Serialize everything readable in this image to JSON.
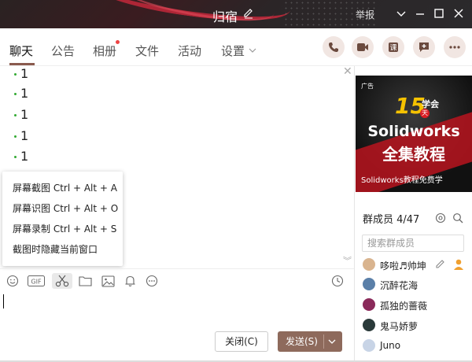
{
  "window": {
    "title": "归宿",
    "report": "举报"
  },
  "tabs": [
    {
      "label": "聊天"
    },
    {
      "label": "公告"
    },
    {
      "label": "相册"
    },
    {
      "label": "文件"
    },
    {
      "label": "活动"
    },
    {
      "label": "设置"
    }
  ],
  "messages": [
    "1",
    "1",
    "1",
    "1",
    "1"
  ],
  "context_menu": [
    "屏幕截图 Ctrl + Alt + A",
    "屏幕识图 Ctrl + Alt + O",
    "屏幕录制 Ctrl + Alt + S",
    "截图时隐藏当前窗口"
  ],
  "toolbar": {
    "gif_label": "GIF"
  },
  "buttons": {
    "close": "关闭(C)",
    "send": "发送(S)"
  },
  "ad": {
    "tag": "广告",
    "num": "15",
    "xuehui": "学会",
    "tian": "天",
    "line1": "Solidworks",
    "line2": "全集教程",
    "footer": "Solidworks教程免费学"
  },
  "members": {
    "header": "群成员 4/47",
    "search_placeholder": "搜索群成员",
    "list": [
      {
        "name": "哆啦♬帅坤"
      },
      {
        "name": "沉醉花海"
      },
      {
        "name": "孤独的蔷薇"
      },
      {
        "name": "鬼马娇萝"
      },
      {
        "name": "Juno"
      }
    ]
  },
  "colors": {
    "accent": "#8e6a5c",
    "tab_underline": "#8a5b4e",
    "ad_red": "#b9141e",
    "ad_yellow": "#f5c200"
  }
}
